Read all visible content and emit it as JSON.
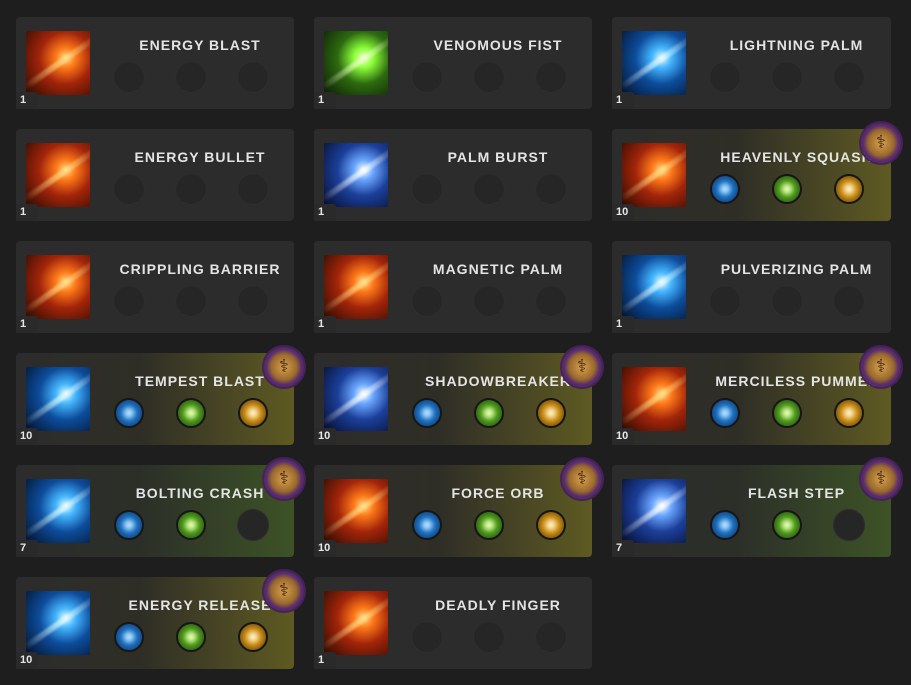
{
  "skills": [
    {
      "name": "ENERGY BLAST",
      "level": "1",
      "tier": "none",
      "rune": false,
      "art": "fire",
      "tripods": [
        null,
        null,
        null
      ]
    },
    {
      "name": "VENOMOUS FIST",
      "level": "1",
      "tier": "none",
      "rune": false,
      "art": "poison",
      "tripods": [
        null,
        null,
        null
      ]
    },
    {
      "name": "LIGHTNING PALM",
      "level": "1",
      "tier": "none",
      "rune": false,
      "art": "ice",
      "tripods": [
        null,
        null,
        null
      ]
    },
    {
      "name": "ENERGY BULLET",
      "level": "1",
      "tier": "none",
      "rune": false,
      "art": "fire",
      "tripods": [
        null,
        null,
        null
      ]
    },
    {
      "name": "PALM BURST",
      "level": "1",
      "tier": "none",
      "rune": false,
      "art": "light",
      "tripods": [
        null,
        null,
        null
      ]
    },
    {
      "name": "HEAVENLY SQUASH",
      "level": "10",
      "tier": "gold",
      "rune": true,
      "art": "fire",
      "tripods": [
        "blue",
        "green",
        "yellow"
      ]
    },
    {
      "name": "CRIPPLING BARRIER",
      "level": "1",
      "tier": "none",
      "rune": false,
      "art": "fire",
      "tripods": [
        null,
        null,
        null
      ]
    },
    {
      "name": "MAGNETIC PALM",
      "level": "1",
      "tier": "none",
      "rune": false,
      "art": "fire",
      "tripods": [
        null,
        null,
        null
      ]
    },
    {
      "name": "PULVERIZING PALM",
      "level": "1",
      "tier": "none",
      "rune": false,
      "art": "ice",
      "tripods": [
        null,
        null,
        null
      ]
    },
    {
      "name": "TEMPEST BLAST",
      "level": "10",
      "tier": "gold",
      "rune": true,
      "art": "ice",
      "tripods": [
        "blue",
        "green",
        "yellow"
      ]
    },
    {
      "name": "SHADOWBREAKER",
      "level": "10",
      "tier": "gold",
      "rune": true,
      "art": "light",
      "tripods": [
        "blue",
        "green",
        "yellow"
      ]
    },
    {
      "name": "MERCILESS PUMMEL",
      "level": "10",
      "tier": "gold",
      "rune": true,
      "art": "fire",
      "tripods": [
        "blue",
        "green",
        "yellow"
      ]
    },
    {
      "name": "BOLTING CRASH",
      "level": "7",
      "tier": "green",
      "rune": true,
      "art": "ice",
      "tripods": [
        "blue",
        "green",
        null
      ]
    },
    {
      "name": "FORCE ORB",
      "level": "10",
      "tier": "gold",
      "rune": true,
      "art": "fire",
      "tripods": [
        "blue",
        "green",
        "yellow"
      ]
    },
    {
      "name": "FLASH STEP",
      "level": "7",
      "tier": "green",
      "rune": true,
      "art": "light",
      "tripods": [
        "blue",
        "green",
        null
      ]
    },
    {
      "name": "ENERGY RELEASE",
      "level": "10",
      "tier": "gold",
      "rune": true,
      "art": "ice",
      "tripods": [
        "blue",
        "green",
        "yellow"
      ]
    },
    {
      "name": "DEADLY FINGER",
      "level": "1",
      "tier": "none",
      "rune": false,
      "art": "fire",
      "tripods": [
        null,
        null,
        null
      ]
    }
  ],
  "colors": {
    "background": "#1e1e1e",
    "card": "#2c2c2c",
    "gold_glow": "#5e5a22",
    "green_glow": "#3d5326",
    "rune_purple": "#46215a"
  }
}
